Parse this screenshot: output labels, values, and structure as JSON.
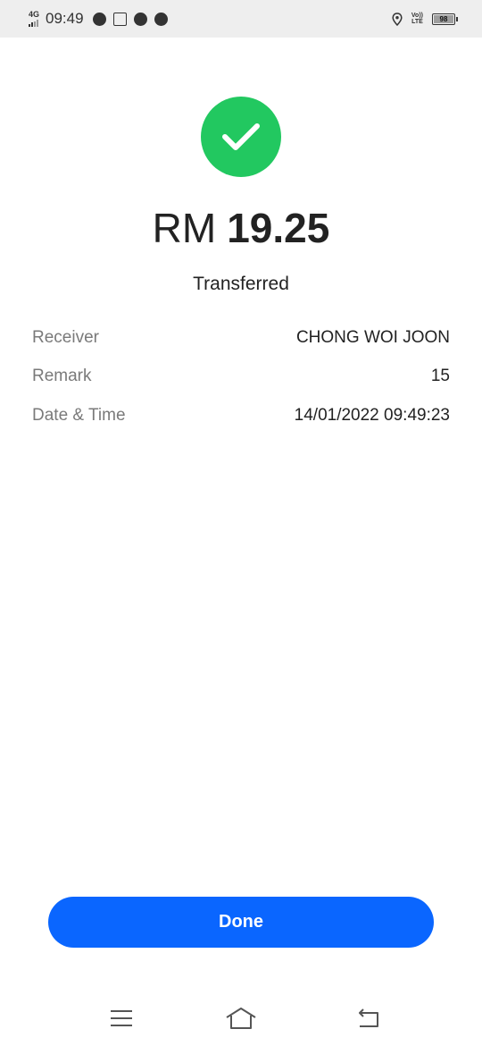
{
  "status_bar": {
    "network": "4G",
    "time": "09:49",
    "left_icons": [
      "messenger-icon",
      "news-app-icon",
      "telegram-icon",
      "wechat-icon"
    ],
    "right_icons": [
      "location-icon",
      "volte-icon",
      "battery-icon"
    ],
    "volte_top": "Vo))",
    "volte_bottom": "LTE",
    "battery": "98"
  },
  "receipt": {
    "currency": "RM",
    "amount": "19.25",
    "status": "Transferred",
    "success_color": "#22c860",
    "details": [
      {
        "label": "Receiver",
        "value": "CHONG WOI JOON"
      },
      {
        "label": "Remark",
        "value": "15"
      },
      {
        "label": "Date & Time",
        "value": "14/01/2022 09:49:23"
      }
    ]
  },
  "actions": {
    "done_label": "Done",
    "accent_color": "#0a66ff"
  },
  "nav": {
    "icons": [
      "menu-icon",
      "home-icon",
      "back-icon"
    ]
  }
}
